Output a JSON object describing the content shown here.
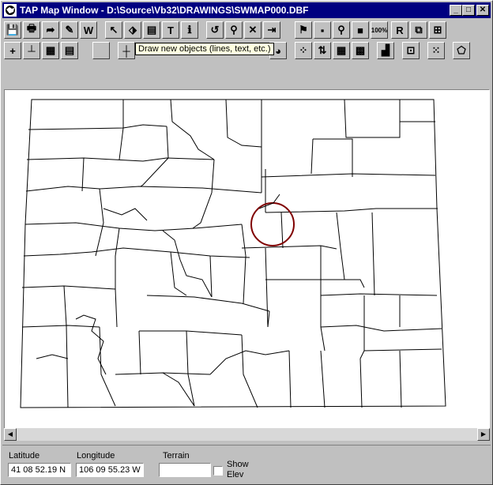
{
  "window": {
    "title": "TAP Map Window - D:\\Source\\Vb32\\DRAWINGS\\SWMAP000.DBF",
    "minimize_glyph": "_",
    "maximize_glyph": "□",
    "close_glyph": "✕"
  },
  "toolbar1": [
    {
      "name": "save-icon",
      "glyph": "💾"
    },
    {
      "name": "print-icon",
      "glyph": "🖶"
    },
    {
      "name": "export-arrow-icon",
      "glyph": "➦"
    },
    {
      "name": "edit-sheet-icon",
      "glyph": "✎"
    },
    {
      "name": "w-tool-icon",
      "glyph": "W"
    },
    {
      "name": "pointer-icon",
      "glyph": "↖"
    },
    {
      "name": "select-objects-icon",
      "glyph": "⬗"
    },
    {
      "name": "layers-icon",
      "glyph": "▤"
    },
    {
      "name": "text-tool-icon",
      "glyph": "T"
    },
    {
      "name": "info-icon",
      "glyph": "ℹ"
    },
    {
      "name": "undo-arrow-icon",
      "glyph": "↺"
    },
    {
      "name": "wand-icon",
      "glyph": "⚲"
    },
    {
      "name": "delete-x-icon",
      "glyph": "✕"
    },
    {
      "name": "exit-door-icon",
      "glyph": "⇥"
    },
    {
      "name": "green-flag-icon",
      "glyph": "⚑"
    },
    {
      "name": "small-square-icon",
      "glyph": "▪"
    },
    {
      "name": "pin-icon",
      "glyph": "⚲"
    },
    {
      "name": "red-block-icon",
      "glyph": "■"
    },
    {
      "name": "zoom-100-icon",
      "glyph": "100%"
    },
    {
      "name": "r-tool-icon",
      "glyph": "R"
    },
    {
      "name": "copy-layer-icon",
      "glyph": "⧉"
    },
    {
      "name": "overlay-icon",
      "glyph": "⊞"
    }
  ],
  "toolbar2": [
    {
      "name": "add-point-icon",
      "glyph": "+"
    },
    {
      "name": "scale-bar-icon",
      "glyph": "┴"
    },
    {
      "name": "grid-icon",
      "glyph": "▦"
    },
    {
      "name": "notes-icon",
      "glyph": "▤"
    },
    {
      "name": "blank-tool-icon",
      "glyph": ""
    },
    {
      "name": "draw-line-icon",
      "glyph": "┼"
    },
    {
      "name": "pie-chart-icon",
      "glyph": "◕"
    },
    {
      "name": "scatter-points-icon",
      "glyph": "⁘"
    },
    {
      "name": "red-arrows-icon",
      "glyph": "⇅"
    },
    {
      "name": "table-grid-icon",
      "glyph": "▦"
    },
    {
      "name": "color-grid-icon",
      "glyph": "▩"
    },
    {
      "name": "histogram-icon",
      "glyph": "▟"
    },
    {
      "name": "network-icon",
      "glyph": "⊡"
    },
    {
      "name": "dotted-grid-icon",
      "glyph": "⁙"
    },
    {
      "name": "polygon-icon",
      "glyph": "⬠"
    }
  ],
  "tooltip": "Draw new objects (lines, text, etc.)",
  "status": {
    "latitude_label": "Latitude",
    "latitude_value": "41 08 52.19 N",
    "longitude_label": "Longitude",
    "longitude_value": "106 09 55.23 W",
    "terrain_label": "Terrain",
    "terrain_value": "",
    "show_elev_line1": "Show",
    "show_elev_line2": "Elev"
  },
  "scroll": {
    "left_glyph": "◀",
    "right_glyph": "▶"
  },
  "colors": {
    "title_bar": "#000080",
    "map_bg": "#ffffff",
    "circle": "#800000",
    "tooltip_bg": "#ffffe1"
  }
}
